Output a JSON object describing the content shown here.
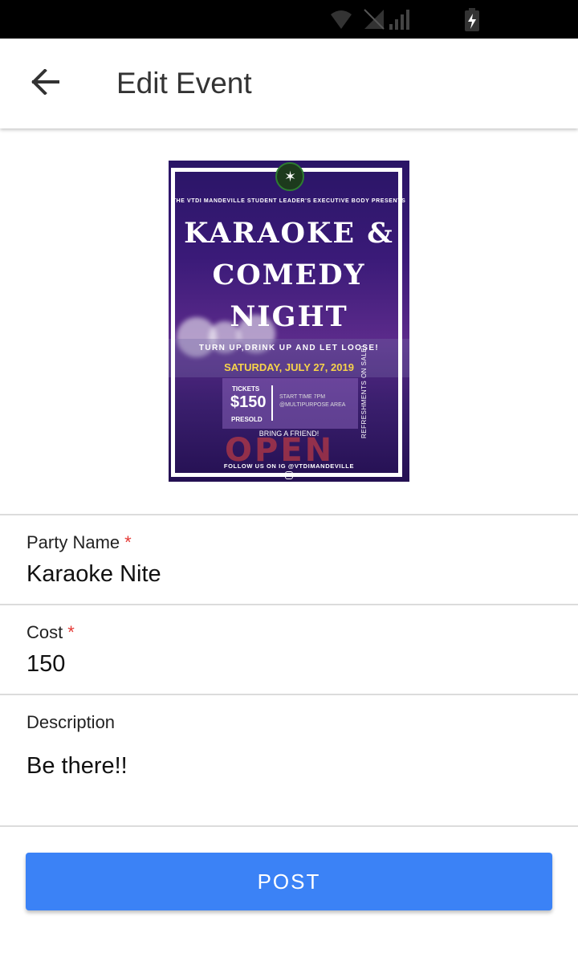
{
  "status_bar": {
    "icons": [
      "wifi-off-icon",
      "signal-off-icon",
      "signal-bars-icon",
      "battery-charging-icon"
    ]
  },
  "header": {
    "back_icon": "arrow-left-icon",
    "title": "Edit Event"
  },
  "poster": {
    "presenter": "THE VTDI MANDEVILLE STUDENT LEADER'S EXECUTIVE BODY PRESENTS",
    "title_line1": "KARAOKE &",
    "title_line2": "COMEDY",
    "title_line3": "NIGHT",
    "tagline": "TURN UP,DRINK UP AND LET LOOSE!",
    "date": "SATURDAY, JULY 27, 2019",
    "tickets_label": "TICKETS",
    "price": "$150",
    "presold": "PRESOLD",
    "info": "START TIME 7PM @MULTIPURPOSE AREA",
    "bring": "BRING A FRIEND!",
    "open_sign": "OPEN",
    "follow": "FOLLOW US ON IG @VTDIMANDEVILLE",
    "side_text": "REFRESHMENTS ON SALE!"
  },
  "form": {
    "party_name": {
      "label": "Party Name",
      "required_mark": "*",
      "value": "Karaoke Nite"
    },
    "cost": {
      "label": "Cost",
      "required_mark": "*",
      "value": "150"
    },
    "description": {
      "label": "Description",
      "value": "Be there!!"
    }
  },
  "actions": {
    "post_label": "POST"
  },
  "colors": {
    "accent": "#3b82f6",
    "required": "#e53935",
    "date_highlight": "#f7d34a"
  }
}
